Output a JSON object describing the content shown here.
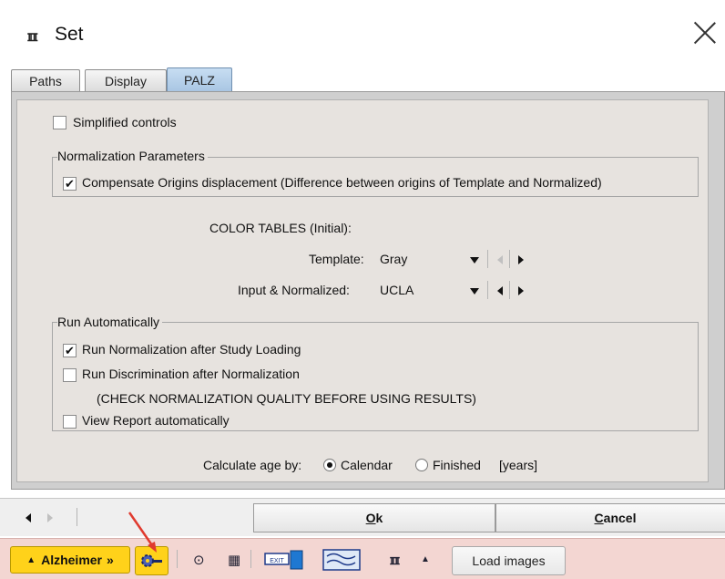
{
  "window": {
    "title": "Set",
    "app_icon_glyph": "ℼ",
    "close_glyph": "close-icon"
  },
  "tabs": [
    {
      "label": "Paths",
      "active": false
    },
    {
      "label": "Display",
      "active": false
    },
    {
      "label": "PALZ",
      "active": true
    }
  ],
  "settings": {
    "simplified_controls": {
      "label": "Simplified controls",
      "checked": false
    },
    "normalization_group": {
      "title": "Normalization Parameters",
      "compensate": {
        "label": "Compensate Origins displacement (Difference between origins of Template and Normalized)",
        "checked": true
      }
    },
    "color_tables": {
      "heading": "COLOR TABLES (Initial):",
      "template": {
        "label": "Template:",
        "value": "Gray"
      },
      "input_normalized": {
        "label": "Input & Normalized:",
        "value": "UCLA"
      }
    },
    "run_group": {
      "title": "Run Automatically",
      "run_normalization": {
        "label": "Run Normalization after Study Loading",
        "checked": true
      },
      "run_discrimination": {
        "label": "Run Discrimination after Normalization",
        "checked": false
      },
      "warning": "(CHECK NORMALIZATION QUALITY BEFORE USING RESULTS)",
      "view_report": {
        "label": "View Report automatically",
        "checked": false
      }
    },
    "age": {
      "label": "Calculate age by:",
      "options": [
        {
          "label": "Calendar",
          "selected": true
        },
        {
          "label": "Finished",
          "selected": false
        }
      ],
      "unit": "[years]"
    }
  },
  "buttons": {
    "ok_mnemonic": "O",
    "ok_rest": "k",
    "cancel_mnemonic": "C",
    "cancel_rest": "ancel"
  },
  "taskbar": {
    "alzheimer_label": "Alzheimer",
    "load_images_label": "Load images"
  },
  "colors": {
    "accent_yellow": "#ffd21a",
    "taskbar_bg": "#f3d6d2",
    "panel_bg": "#e7e3df",
    "active_tab": "#b4cde8",
    "annotation_arrow": "#e03a2e"
  }
}
